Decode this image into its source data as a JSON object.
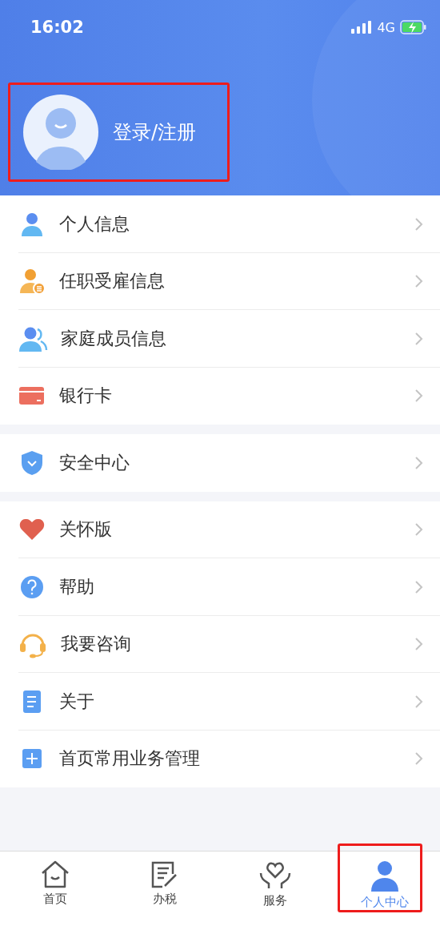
{
  "status_bar": {
    "time": "16:02",
    "network": "4G",
    "charging": true
  },
  "profile": {
    "label": "登录/注册",
    "highlighted": true
  },
  "menu_groups": [
    {
      "items": [
        {
          "label": "个人信息"
        },
        {
          "label": "任职受雇信息"
        },
        {
          "label": "家庭成员信息"
        },
        {
          "label": "银行卡"
        }
      ]
    },
    {
      "items": [
        {
          "label": "安全中心"
        }
      ]
    },
    {
      "items": [
        {
          "label": "关怀版"
        },
        {
          "label": "帮助"
        },
        {
          "label": "我要咨询"
        },
        {
          "label": "关于"
        },
        {
          "label": "首页常用业务管理"
        }
      ]
    }
  ],
  "tab_bar": [
    {
      "label": "首页",
      "selected": false,
      "highlighted": false
    },
    {
      "label": "办税",
      "selected": false,
      "highlighted": false
    },
    {
      "label": "服务",
      "selected": false,
      "highlighted": false
    },
    {
      "label": "个人中心",
      "selected": true,
      "highlighted": true
    }
  ]
}
